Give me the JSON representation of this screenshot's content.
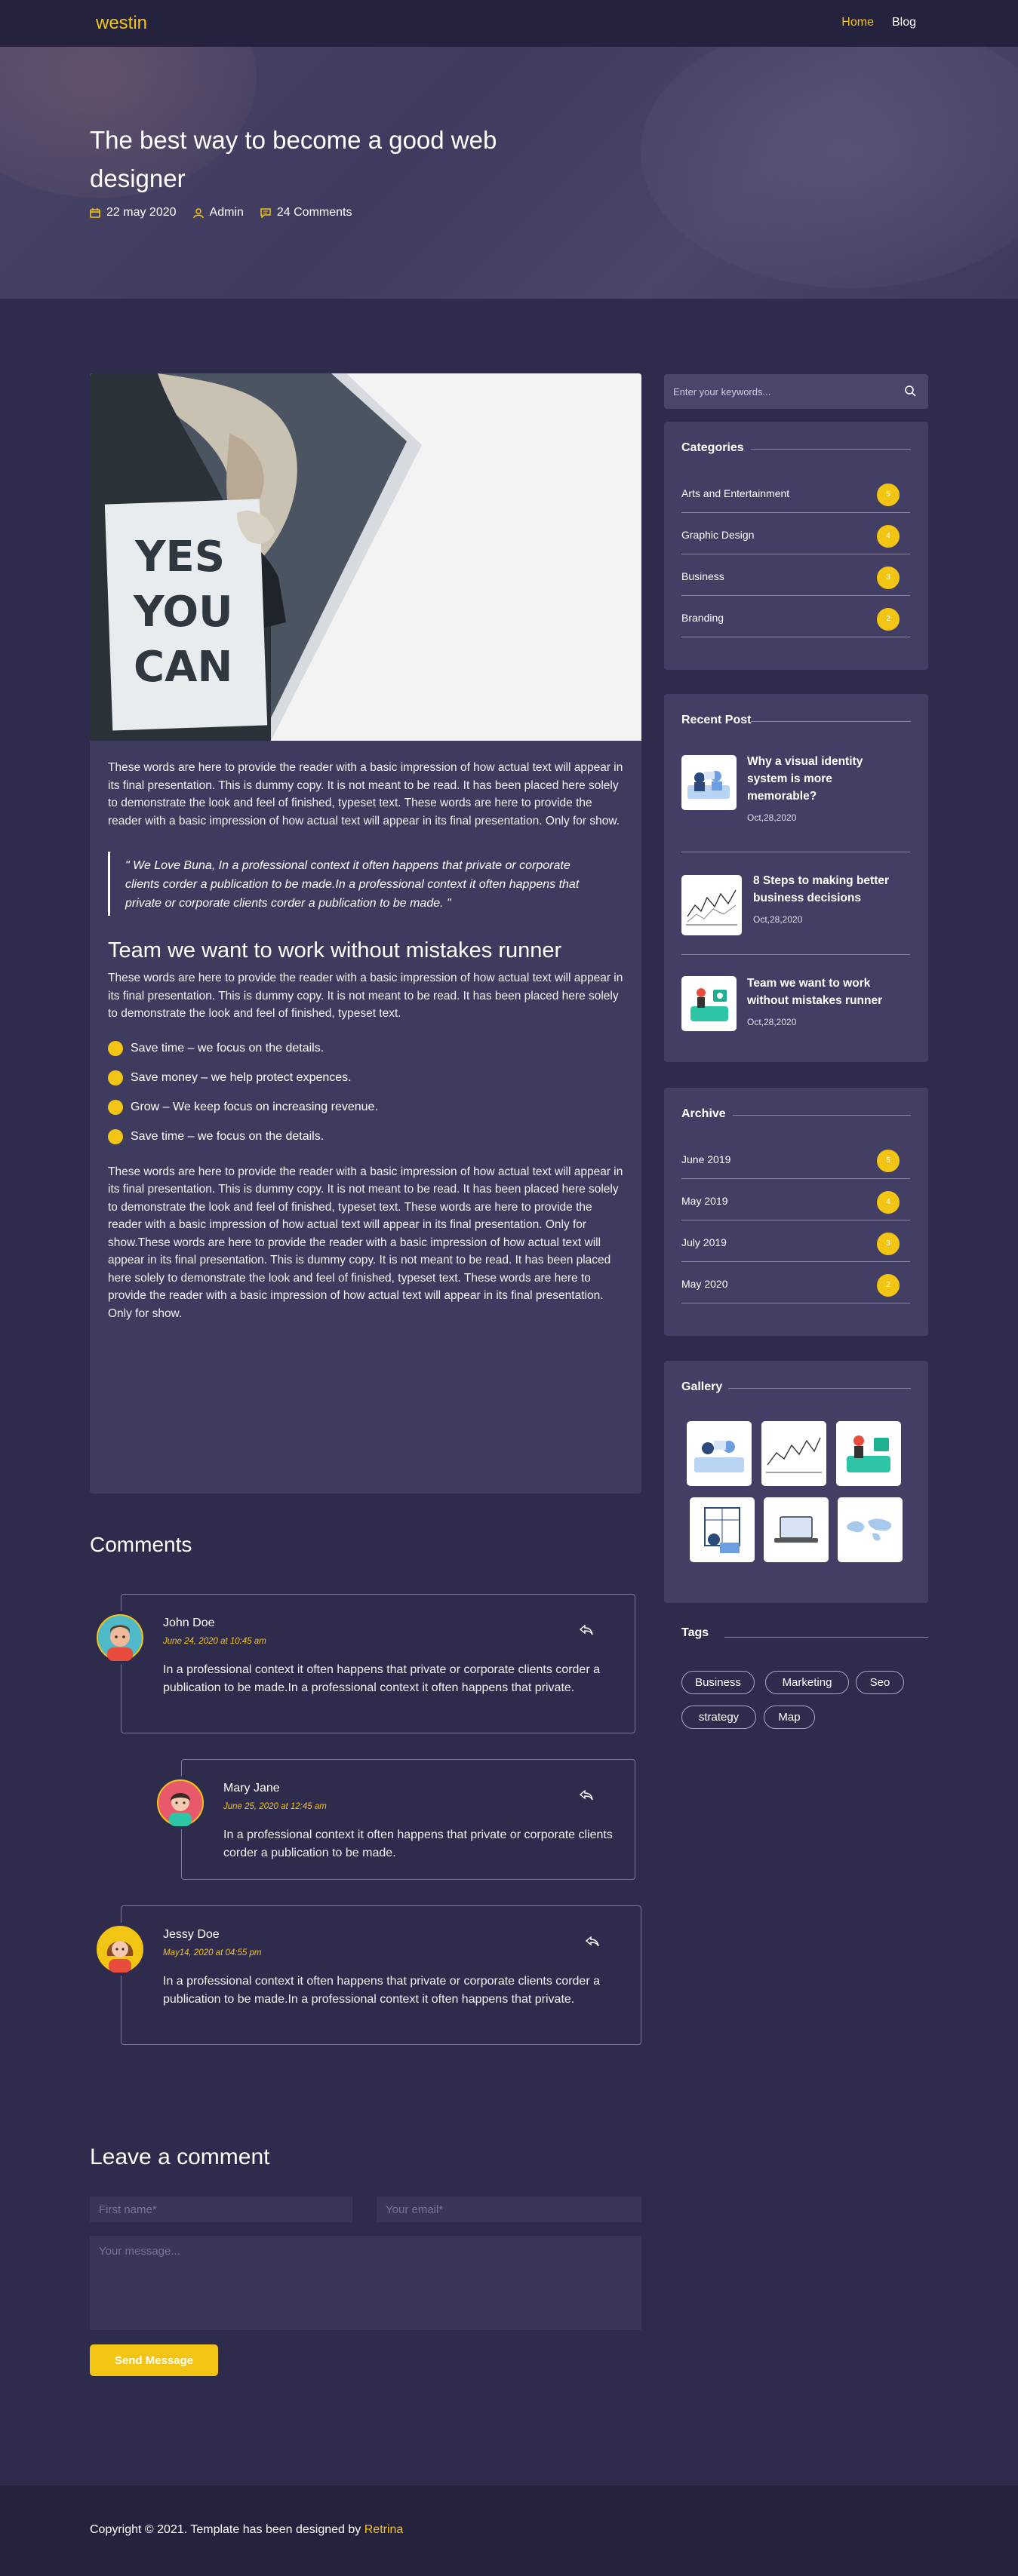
{
  "nav": {
    "logo": "westin",
    "links": [
      "Home",
      "Blog"
    ]
  },
  "hero": {
    "title": "The best way to become a good web designer",
    "date": "22 may 2020",
    "author": "Admin",
    "comments": "24 Comments"
  },
  "post": {
    "image_text": [
      "YES",
      "YOU",
      "CAN"
    ],
    "intro": "These words are here to provide the reader with a basic impression of how actual text will appear in its final presentation. This is dummy copy. It is not meant to be read. It has been placed here solely to demonstrate the look and feel of finished, typeset text. These words are here to provide the reader with a basic impression of how actual text will appear in its final presentation. Only for show.",
    "quote": "\" We Love Buna, In a professional context it often happens that private or corporate clients corder a publication to be made.In a professional context it often happens that private or corporate clients corder a publication to be made. \"",
    "heading": "Team we want to work without mistakes runner",
    "para2": "These words are here to provide the reader with a basic impression of how actual text will appear in its final presentation. This is dummy copy. It is not meant to be read. It has been placed here solely to demonstrate the look and feel of finished, typeset text.",
    "list": [
      "Save time – we focus on the details.",
      "Save money – we help protect expences.",
      "Grow – We keep focus on increasing revenue.",
      "Save time – we focus on the details."
    ],
    "para3": "These words are here to provide the reader with a basic impression of how actual text will appear in its final presentation. This is dummy copy. It is not meant to be read. It has been placed here solely to demonstrate the look and feel of finished, typeset text. These words are here to provide the reader with a basic impression of how actual text will appear in its final presentation. Only for show.These words are here to provide the reader with a basic impression of how actual text will appear in its final presentation. This is dummy copy. It is not meant to be read. It has been placed here solely to demonstrate the look and feel of finished, typeset text. These words are here to provide the reader with a basic impression of how actual text will appear in its final presentation. Only for show."
  },
  "sidebar": {
    "search_placeholder": "Enter your keywords...",
    "categories": {
      "title": "Categories",
      "items": [
        {
          "label": "Arts and Entertainment",
          "count": "5"
        },
        {
          "label": "Graphic Design",
          "count": "4"
        },
        {
          "label": "Business",
          "count": "3"
        },
        {
          "label": "Branding",
          "count": "2"
        }
      ]
    },
    "recent": {
      "title": "Recent Post",
      "items": [
        {
          "title": "Why a visual identity system is more memorable?",
          "date": "Oct,28,2020"
        },
        {
          "title": "8 Steps to making better business decisions",
          "date": "Oct,28,2020"
        },
        {
          "title": "Team we want to work without mistakes runner",
          "date": "Oct,28,2020"
        }
      ]
    },
    "archive": {
      "title": "Archive",
      "items": [
        {
          "label": "June 2019",
          "count": "5"
        },
        {
          "label": "May 2019",
          "count": "4"
        },
        {
          "label": "July 2019",
          "count": "3"
        },
        {
          "label": "May 2020",
          "count": "2"
        }
      ]
    },
    "gallery": {
      "title": "Gallery"
    },
    "tags": {
      "title": "Tags",
      "items": [
        "Business",
        "Marketing",
        "Seo",
        "strategy",
        "Map"
      ]
    }
  },
  "comments": {
    "title": "Comments",
    "items": [
      {
        "name": "John Doe",
        "date": "June 24, 2020 at 10:45 am",
        "text": "In a professional context it often happens that private or corporate clients corder a publication to be made.In a professional context it often happens that private."
      },
      {
        "name": "Mary Jane",
        "date": "June 25, 2020 at 12:45 am",
        "text": "In a professional context it often happens that private or corporate clients corder a publication to be made."
      },
      {
        "name": "Jessy Doe",
        "date": "May14, 2020 at 04:55 pm",
        "text": "In a professional context it often happens that private or corporate clients corder a publication to be made.In a professional context it often happens that private."
      }
    ]
  },
  "form": {
    "title": "Leave a comment",
    "first_name_placeholder": "First name*",
    "email_placeholder": "Your email*",
    "message_placeholder": "Your message...",
    "send_label": "Send Message"
  },
  "footer": {
    "copyright": "Copyright © 2021. Template has been designed by",
    "brand": "Retrina"
  }
}
